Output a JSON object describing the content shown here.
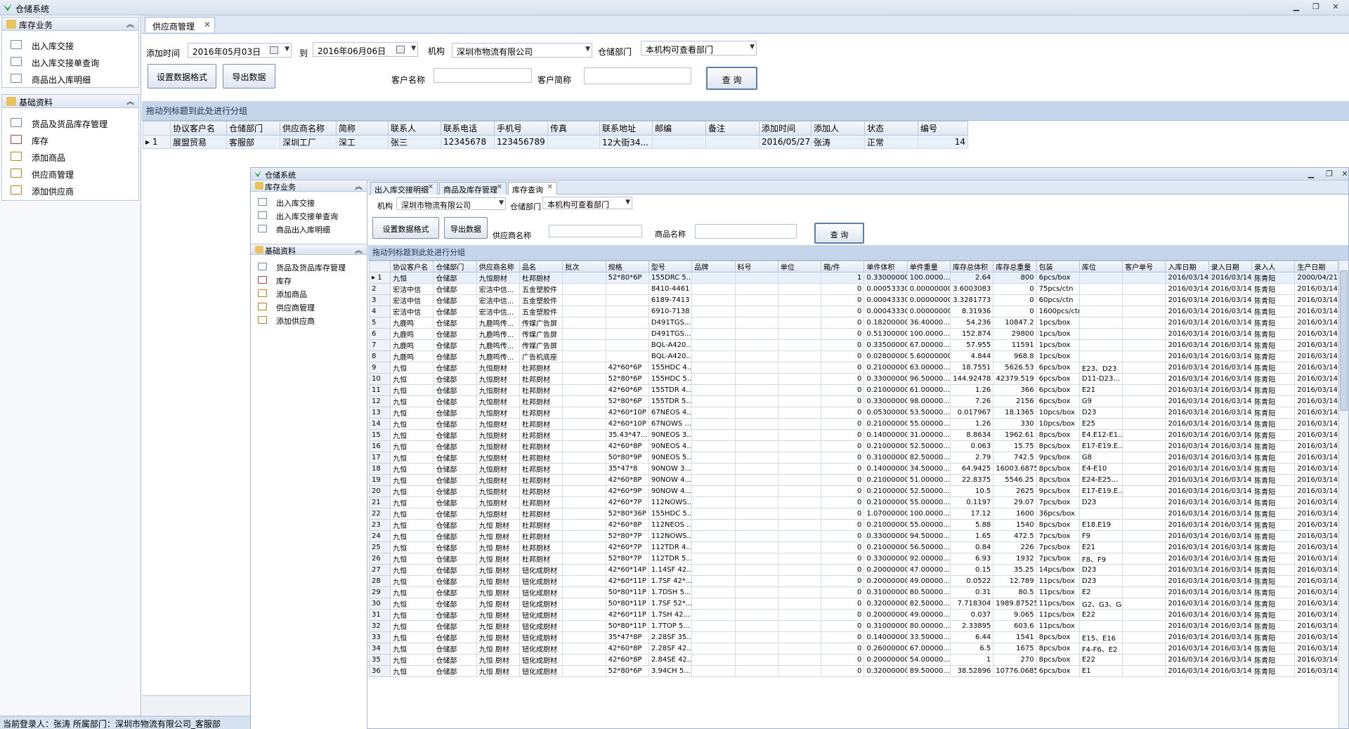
{
  "main": {
    "title": "仓储系统",
    "sidebar": {
      "sections": [
        {
          "label": "库存业务",
          "items": [
            "出入库交接",
            "出入库交接单查询",
            "商品出入库明细"
          ]
        },
        {
          "label": "基础资料",
          "items": [
            "货品及货品库存管理",
            "库存",
            "添加商品",
            "供应商管理",
            "添加供应商"
          ]
        }
      ]
    },
    "tab": "供应商管理",
    "filters": {
      "add_time_label": "添加时间",
      "date_from": "2016年05月03日",
      "to_label": "到",
      "date_to": "2016年06月06日",
      "org_label": "机构",
      "org_value": "深圳市物流有限公司",
      "dept_label": "仓储部门",
      "dept_value": "本机构可查看部门",
      "customer_name_label": "客户名称",
      "customer_abbr_label": "客户简称"
    },
    "buttons": {
      "format": "设置数据格式",
      "export": "导出数据",
      "query": "查 询"
    },
    "group_hint": "拖动列标题到此处进行分组",
    "columns": [
      "协议客户名",
      "仓储部门",
      "供应商名称",
      "简称",
      "联系人",
      "联系电话",
      "手机号",
      "传真",
      "联系地址",
      "邮编",
      "备注",
      "添加时间",
      "添加人",
      "状态",
      "编号"
    ],
    "rows": [
      [
        "1",
        "展盟贸易",
        "客服部",
        "深圳工厂",
        "深工",
        "张三",
        "12345678",
        "123456789",
        "",
        "12大街34...",
        "",
        "",
        "2016/05/27",
        "张涛",
        "正常",
        "14"
      ]
    ]
  },
  "status": "当前登录人：张涛  所属部门：深圳市物流有限公司_客服部",
  "sub": {
    "title": "仓储系统",
    "sidebar": {
      "sections": [
        {
          "label": "库存业务",
          "items": [
            "出入库交接",
            "出入库交接单查询",
            "商品出入库明细"
          ]
        },
        {
          "label": "基础资料",
          "items": [
            "货品及货品库存管理",
            "库存",
            "添加商品",
            "供应商管理",
            "添加供应商"
          ]
        }
      ]
    },
    "tabs": [
      "出入库交接明细",
      "商品及库存管理",
      "库存查询"
    ],
    "filters": {
      "org_label": "机构",
      "org_value": "深圳市物流有限公司",
      "dept_label": "仓储部门",
      "dept_value": "本机构可查看部门",
      "supplier_label": "供应商名称",
      "product_label": "商品名称"
    },
    "buttons": {
      "format": "设置数据格式",
      "export": "导出数据",
      "query": "查 询"
    },
    "group_hint": "拖动列标题到此处进行分组",
    "columns": [
      "协议客户名",
      "仓储部门",
      "供应商名称",
      "品名",
      "批次",
      "规格",
      "型号",
      "品牌",
      "料号",
      "单位",
      "箱/件",
      "单件体积",
      "单件重量",
      "库存总体积",
      "库存总重量",
      "包装",
      "库位",
      "客户单号",
      "入库日期",
      "录入日期",
      "录入人",
      "生产日期"
    ],
    "rows": [
      [
        "1",
        "九恒",
        "仓储部",
        "九恒厨材",
        "杜邦厨材",
        "",
        "52*80*6P",
        "155DRC 5...",
        "",
        "",
        "",
        "1",
        "0.33000000",
        "100.0000...",
        "2.64",
        "800",
        "6pcs/box",
        "",
        "",
        "2016/03/14",
        "2016/03/14",
        "陈青阳",
        "2000/04/21"
      ],
      [
        "2",
        "宏洁中信",
        "仓储部",
        "宏洁中信...",
        "五金塑胶件",
        "",
        "",
        "8410-4461",
        "",
        "",
        "",
        "0",
        "0.00053330",
        "0.00000000",
        "3.6003083",
        "0",
        "75pcs/ctn",
        "",
        "",
        "2016/03/14",
        "2016/03/14",
        "陈青阳",
        "2016/03/14"
      ],
      [
        "3",
        "宏洁中信",
        "仓储部",
        "宏洁中信...",
        "五金塑胶件",
        "",
        "",
        "6189-7413",
        "",
        "",
        "",
        "0",
        "0.00043330",
        "0.00000000",
        "3.3281773",
        "0",
        "60pcs/ctn",
        "",
        "",
        "2016/03/14",
        "2016/03/14",
        "陈青阳",
        "2016/03/14"
      ],
      [
        "4",
        "宏洁中信",
        "仓储部",
        "宏洁中信...",
        "五金塑胶件",
        "",
        "",
        "6910-7138",
        "",
        "",
        "",
        "0",
        "0.00043330",
        "0.00000000",
        "8.31936",
        "0",
        "1600pcs/ctn",
        "",
        "",
        "2016/03/14",
        "2016/03/14",
        "陈青阳",
        "2016/03/14"
      ],
      [
        "5",
        "九鹿鸣",
        "仓储部",
        "九鹿鸣传...",
        "传媒广告屏",
        "",
        "",
        "D491TGS...",
        "",
        "",
        "",
        "0",
        "0.18200000",
        "36.40000...",
        "54.236",
        "10847.2",
        "1pcs/box",
        "",
        "",
        "2016/03/14",
        "2016/03/14",
        "陈青阳",
        "2016/03/14"
      ],
      [
        "6",
        "九鹿鸣",
        "仓储部",
        "九鹿鸣传...",
        "传媒广告屏",
        "",
        "",
        "D491TGS...",
        "",
        "",
        "",
        "0",
        "0.51300000",
        "100.0000...",
        "152.874",
        "29800",
        "1pcs/box",
        "",
        "",
        "2016/03/14",
        "2016/03/14",
        "陈青阳",
        "2016/03/14"
      ],
      [
        "7",
        "九鹿鸣",
        "仓储部",
        "九鹿鸣传...",
        "传媒广告屏",
        "",
        "",
        "BQL-A420...",
        "",
        "",
        "",
        "0",
        "0.33500000",
        "67.00000...",
        "57.955",
        "11591",
        "1pcs/box",
        "",
        "",
        "2016/03/14",
        "2016/03/14",
        "陈青阳",
        "2016/03/14"
      ],
      [
        "8",
        "九鹿鸣",
        "仓储部",
        "九鹿鸣传...",
        "广告机底座",
        "",
        "",
        "BQL-A420...",
        "",
        "",
        "",
        "0",
        "0.02800000",
        "5.60000000",
        "4.844",
        "968.8",
        "1pcs/box",
        "",
        "",
        "2016/03/14",
        "2016/03/14",
        "陈青阳",
        "2016/03/14"
      ],
      [
        "9",
        "九恒",
        "仓储部",
        "九恒厨材",
        "杜邦厨材",
        "",
        "42*60*6P",
        "155HDC 4...",
        "",
        "",
        "",
        "0",
        "0.21000000",
        "63.00000...",
        "18.7551",
        "5626.53",
        "6pcs/box",
        "E23、D23",
        "",
        "2016/03/14",
        "2016/03/14",
        "陈青阳",
        "2016/03/14"
      ],
      [
        "10",
        "九恒",
        "仓储部",
        "九恒厨材",
        "杜邦厨材",
        "",
        "52*80*6P",
        "155HDC 5...",
        "",
        "",
        "",
        "0",
        "0.33000000",
        "96.50000...",
        "144.92478",
        "42379.519",
        "6pcs/box",
        "D11-D23...",
        "",
        "2016/03/14",
        "2016/03/14",
        "陈青阳",
        "2016/03/14"
      ],
      [
        "11",
        "九恒",
        "仓储部",
        "九恒厨材",
        "杜邦厨材",
        "",
        "42*60*6P",
        "155TDR 4...",
        "",
        "",
        "",
        "0",
        "0.21000000",
        "61.00000...",
        "1.26",
        "366",
        "6pcs/box",
        "E21",
        "",
        "2016/03/14",
        "2016/03/14",
        "陈青阳",
        "2016/03/14"
      ],
      [
        "12",
        "九恒",
        "仓储部",
        "九恒厨材",
        "杜邦厨材",
        "",
        "52*80*6P",
        "155TDR 5...",
        "",
        "",
        "",
        "0",
        "0.33000000",
        "98.00000...",
        "7.26",
        "2156",
        "6pcs/box",
        "G9",
        "",
        "2016/03/14",
        "2016/03/14",
        "陈青阳",
        "2016/03/14"
      ],
      [
        "13",
        "九恒",
        "仓储部",
        "九恒厨材",
        "杜邦厨材",
        "",
        "42*60*10P",
        "67NEOS 4...",
        "",
        "",
        "",
        "0",
        "0.05300000",
        "53.50000...",
        "0.017967",
        "18.1365",
        "10pcs/box",
        "D23",
        "",
        "2016/03/14",
        "2016/03/14",
        "陈青阳",
        "2016/03/14"
      ],
      [
        "14",
        "九恒",
        "仓储部",
        "九恒厨材",
        "杜邦厨材",
        "",
        "42*60*10P",
        "67NOWS ...",
        "",
        "",
        "",
        "0",
        "0.21000000",
        "55.00000...",
        "1.26",
        "330",
        "10pcs/box",
        "E25",
        "",
        "2016/03/14",
        "2016/03/14",
        "陈青阳",
        "2016/03/14"
      ],
      [
        "15",
        "九恒",
        "仓储部",
        "九恒厨材",
        "杜邦厨材",
        "",
        "35.43*47...",
        "90NEOS 3...",
        "",
        "",
        "",
        "0",
        "0.14000000",
        "31.00000...",
        "8.8634",
        "1962.61",
        "8pcs/box",
        "E4.E12-E1...",
        "",
        "2016/03/14",
        "2016/03/14",
        "陈青阳",
        "2016/03/14"
      ],
      [
        "16",
        "九恒",
        "仓储部",
        "九恒厨材",
        "杜邦厨材",
        "",
        "42*60*8P",
        "90NEOS 4...",
        "",
        "",
        "",
        "0",
        "0.21000000",
        "52.50000...",
        "0.063",
        "15.75",
        "8pcs/box",
        "E17-E19.E...",
        "",
        "2016/03/14",
        "2016/03/14",
        "陈青阳",
        "2016/03/14"
      ],
      [
        "17",
        "九恒",
        "仓储部",
        "九恒厨材",
        "杜邦厨材",
        "",
        "50*80*9P",
        "90NEOS 5...",
        "",
        "",
        "",
        "0",
        "0.31000000",
        "82.50000...",
        "2.79",
        "742.5",
        "9pcs/box",
        "G8",
        "",
        "2016/03/14",
        "2016/03/14",
        "陈青阳",
        "2016/03/14"
      ],
      [
        "18",
        "九恒",
        "仓储部",
        "九恒厨材",
        "杜邦厨材",
        "",
        "35*47*8",
        "90NOW 3...",
        "",
        "",
        "",
        "0",
        "0.14000000",
        "34.50000...",
        "64.9425",
        "16003.6875",
        "8pcs/box",
        "E4-E10",
        "",
        "2016/03/14",
        "2016/03/14",
        "陈青阳",
        "2016/03/14"
      ],
      [
        "19",
        "九恒",
        "仓储部",
        "九恒厨材",
        "杜邦厨材",
        "",
        "42*60*8P",
        "90NOW 4...",
        "",
        "",
        "",
        "0",
        "0.21000000",
        "51.00000...",
        "22.8375",
        "5546.25",
        "8pcs/box",
        "E24-E25...",
        "",
        "2016/03/14",
        "2016/03/14",
        "陈青阳",
        "2016/03/14"
      ],
      [
        "20",
        "九恒",
        "仓储部",
        "九恒厨材",
        "杜邦厨材",
        "",
        "42*60*9P",
        "90NOW 4...",
        "",
        "",
        "",
        "0",
        "0.21000000",
        "52.50000...",
        "10.5",
        "2625",
        "9pcs/box",
        "E17-E19.E...",
        "",
        "2016/03/14",
        "2016/03/14",
        "陈青阳",
        "2016/03/14"
      ],
      [
        "21",
        "九恒",
        "仓储部",
        "九恒厨材",
        "杜邦厨材",
        "",
        "42*60*7P",
        "112NOWS...",
        "",
        "",
        "",
        "0",
        "0.21000000",
        "55.00000...",
        "0.1197",
        "29.07",
        "7pcs/box",
        "D23",
        "",
        "2016/03/14",
        "2016/03/14",
        "陈青阳",
        "2016/03/14"
      ],
      [
        "22",
        "九恒",
        "仓储部",
        "九恒厨材",
        "杜邦厨材",
        "",
        "52*80*36P",
        "155HDC 5...",
        "",
        "",
        "",
        "0",
        "1.07000000",
        "100.0000...",
        "17.12",
        "1600",
        "36pcs/box",
        "",
        "",
        "2016/03/14",
        "2016/03/14",
        "陈青阳",
        "2016/03/14"
      ],
      [
        "23",
        "九恒",
        "仓储部",
        "九恒 厨材",
        "杜邦厨材",
        "",
        "42*60*8P",
        "112NEOS ...",
        "",
        "",
        "",
        "0",
        "0.21000000",
        "55.00000...",
        "5.88",
        "1540",
        "8pcs/box",
        "E18.E19",
        "",
        "2016/03/14",
        "2016/03/14",
        "陈青阳",
        "2016/03/14"
      ],
      [
        "24",
        "九恒",
        "仓储部",
        "九恒 厨材",
        "杜邦厨材",
        "",
        "52*80*7P",
        "112NOWS...",
        "",
        "",
        "",
        "0",
        "0.33000000",
        "94.50000...",
        "1.65",
        "472.5",
        "7pcs/box",
        "F9",
        "",
        "2016/03/14",
        "2016/03/14",
        "陈青阳",
        "2016/03/14"
      ],
      [
        "25",
        "九恒",
        "仓储部",
        "九恒 厨材",
        "杜邦厨材",
        "",
        "42*60*7P",
        "112TDR 4...",
        "",
        "",
        "",
        "0",
        "0.21000000",
        "56.50000...",
        "0.84",
        "226",
        "7pcs/box",
        "E21",
        "",
        "2016/03/14",
        "2016/03/14",
        "陈青阳",
        "2016/03/14"
      ],
      [
        "26",
        "九恒",
        "仓储部",
        "九恒 厨材",
        "杜邦厨材",
        "",
        "52*80*7P",
        "112TDR 5...",
        "",
        "",
        "",
        "0",
        "0.33000000",
        "92.00000...",
        "6.93",
        "1932",
        "7pcs/box",
        "F8、F9",
        "",
        "2016/03/14",
        "2016/03/14",
        "陈青阳",
        "2016/03/14"
      ],
      [
        "27",
        "九恒",
        "仓储部",
        "九恒 厨材",
        "钮化成厨材",
        "",
        "42*60*14P",
        "1.14SF 42...",
        "",
        "",
        "",
        "0",
        "0.20000000",
        "47.00000...",
        "0.15",
        "35.25",
        "14pcs/box",
        "D23",
        "",
        "2016/03/14",
        "2016/03/14",
        "陈青阳",
        "2016/03/14"
      ],
      [
        "28",
        "九恒",
        "仓储部",
        "九恒 厨材",
        "钮化成厨材",
        "",
        "42*60*11P",
        "1.7SF 42*...",
        "",
        "",
        "",
        "0",
        "0.20000000",
        "49.00000...",
        "0.0522",
        "12.789",
        "11pcs/box",
        "D23",
        "",
        "2016/03/14",
        "2016/03/14",
        "陈青阳",
        "2016/03/14"
      ],
      [
        "29",
        "九恒",
        "仓储部",
        "九恒 厨材",
        "钮化成厨材",
        "",
        "50*80*11P",
        "1.7DSH 5...",
        "",
        "",
        "",
        "0",
        "0.31000000",
        "80.50000...",
        "0.31",
        "80.5",
        "11pcs/box",
        "E2",
        "",
        "2016/03/14",
        "2016/03/14",
        "陈青阳",
        "2016/03/14"
      ],
      [
        "30",
        "九恒",
        "仓储部",
        "九恒 厨材",
        "钮化成厨材",
        "",
        "50*80*11P",
        "1.7SF 52*...",
        "",
        "",
        "",
        "0",
        "0.32000000",
        "82.50000...",
        "7.718304",
        "1989.87525",
        "11pcs/box",
        "G2、G3、G4",
        "",
        "2016/03/14",
        "2016/03/14",
        "陈青阳",
        "2016/03/14"
      ],
      [
        "31",
        "九恒",
        "仓储部",
        "九恒 厨材",
        "钮化成厨材",
        "",
        "42*60*11P",
        "1.7SH 42...",
        "",
        "",
        "",
        "0",
        "0.20000000",
        "49.00000...",
        "0.037",
        "9.065",
        "11pcs/box",
        "E22",
        "",
        "2016/03/14",
        "2016/03/14",
        "陈青阳",
        "2016/03/14"
      ],
      [
        "32",
        "九恒",
        "仓储部",
        "九恒 厨材",
        "钮化成厨材",
        "",
        "50*80*11P",
        "1.7TOP 5...",
        "",
        "",
        "",
        "0",
        "0.31000000",
        "80.00000...",
        "2.33895",
        "603.6",
        "11pcs/box",
        "",
        "",
        "2016/03/14",
        "2016/03/14",
        "陈青阳",
        "2016/03/14"
      ],
      [
        "33",
        "九恒",
        "仓储部",
        "九恒 厨材",
        "钮化成厨材",
        "",
        "35*47*8P",
        "2.28SF 35...",
        "",
        "",
        "",
        "0",
        "0.14000000",
        "33.50000...",
        "6.44",
        "1541",
        "8pcs/box",
        "E15、E16",
        "",
        "2016/03/14",
        "2016/03/14",
        "陈青阳",
        "2016/03/14"
      ],
      [
        "34",
        "九恒",
        "仓储部",
        "九恒 厨材",
        "钮化成厨材",
        "",
        "42*60*8P",
        "2.28SF 42...",
        "",
        "",
        "",
        "0",
        "0.26000000",
        "67.00000...",
        "6.5",
        "1675",
        "8pcs/box",
        "F4-F6、E2",
        "",
        "2016/03/14",
        "2016/03/14",
        "陈青阳",
        "2016/03/14"
      ],
      [
        "35",
        "九恒",
        "仓储部",
        "九恒 厨材",
        "钮化成厨材",
        "",
        "42*60*8P",
        "2.84SE 42...",
        "",
        "",
        "",
        "0",
        "0.20000000",
        "54.00000...",
        "1",
        "270",
        "8pcs/box",
        "E22",
        "",
        "2016/03/14",
        "2016/03/14",
        "陈青阳",
        "2016/03/14"
      ],
      [
        "36",
        "九恒",
        "仓储部",
        "九恒 厨材",
        "钮化成厨材",
        "",
        "52*80*6P",
        "3.94CH 5...",
        "",
        "",
        "",
        "0",
        "0.32000000",
        "89.50000...",
        "38.52896",
        "10776.0685",
        "6pcs/box",
        "E1",
        "",
        "2016/03/14",
        "2016/03/14",
        "陈青阳",
        "2016/03/14"
      ]
    ]
  }
}
